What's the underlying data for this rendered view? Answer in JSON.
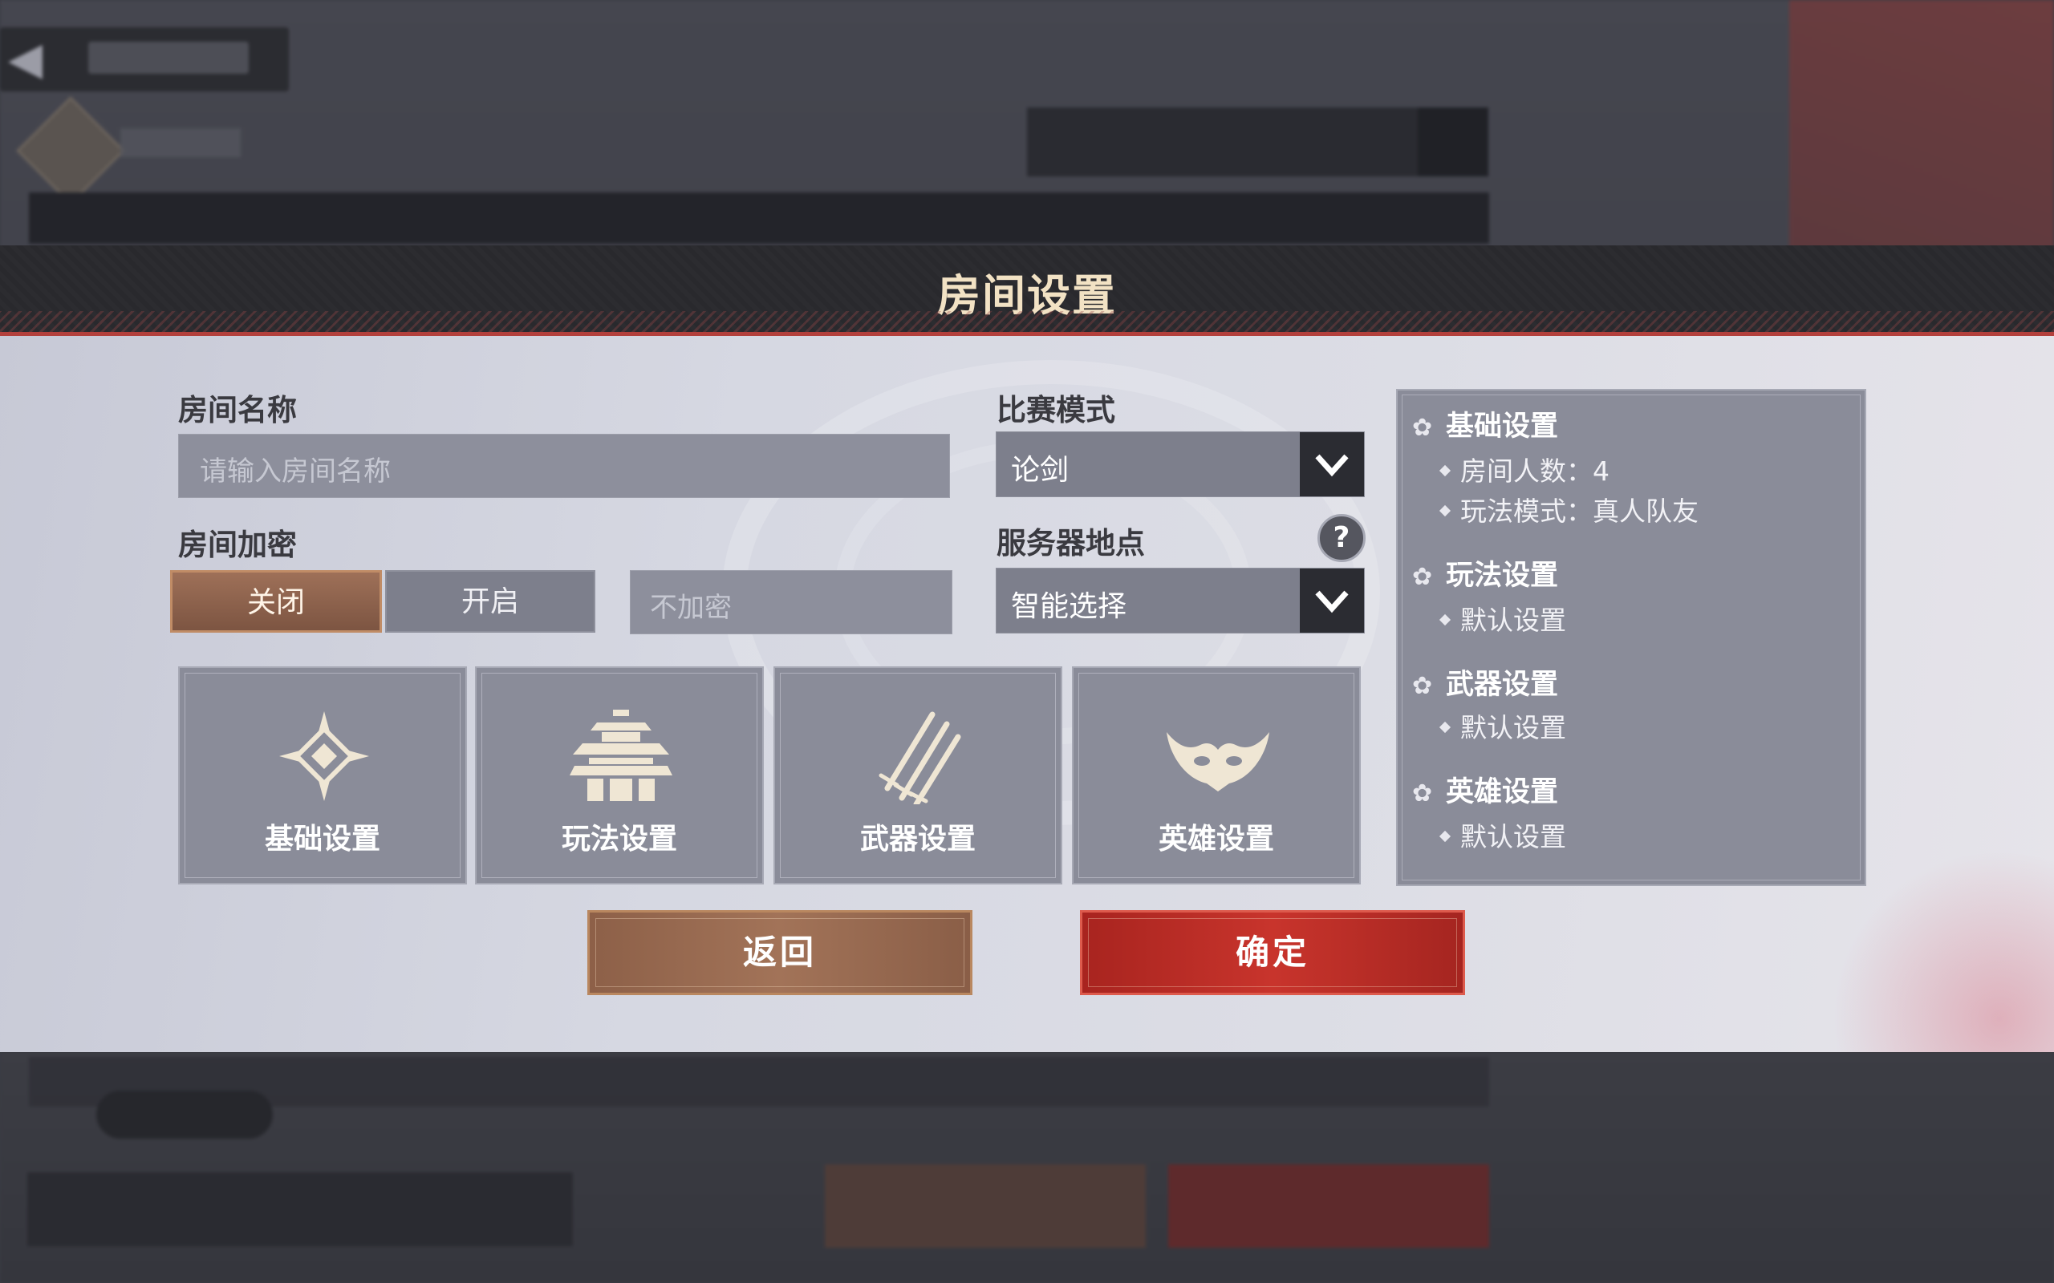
{
  "dialog": {
    "title": "房间设置",
    "room_name": {
      "label": "房间名称",
      "placeholder": "请输入房间名称"
    },
    "encryption": {
      "label": "房间加密",
      "off_label": "关闭",
      "on_label": "开启",
      "selected": "关闭",
      "password_placeholder": "不加密"
    },
    "match_mode": {
      "label": "比赛模式",
      "value": "论剑"
    },
    "server_location": {
      "label": "服务器地点",
      "value": "智能选择",
      "help": "?"
    },
    "cards": [
      {
        "label": "基础设置",
        "icon": "compass-diamond-icon"
      },
      {
        "label": "玩法设置",
        "icon": "pagoda-icon"
      },
      {
        "label": "武器设置",
        "icon": "swords-icon"
      },
      {
        "label": "英雄设置",
        "icon": "horned-mask-icon"
      }
    ],
    "summary": {
      "sections": [
        {
          "title": "基础设置",
          "items": [
            "房间人数：4",
            "玩法模式：真人队友"
          ]
        },
        {
          "title": "玩法设置",
          "items": [
            "默认设置"
          ]
        },
        {
          "title": "武器设置",
          "items": [
            "默认设置"
          ]
        },
        {
          "title": "英雄设置",
          "items": [
            "默认设置"
          ]
        }
      ]
    },
    "buttons": {
      "back": "返回",
      "confirm": "确定"
    }
  },
  "colors": {
    "toggle_on": "#9e7058",
    "back_button": "#a27358",
    "confirm_button": "#c8342c",
    "header_accent": "#b3403c",
    "title_text": "#f2e2c4"
  }
}
